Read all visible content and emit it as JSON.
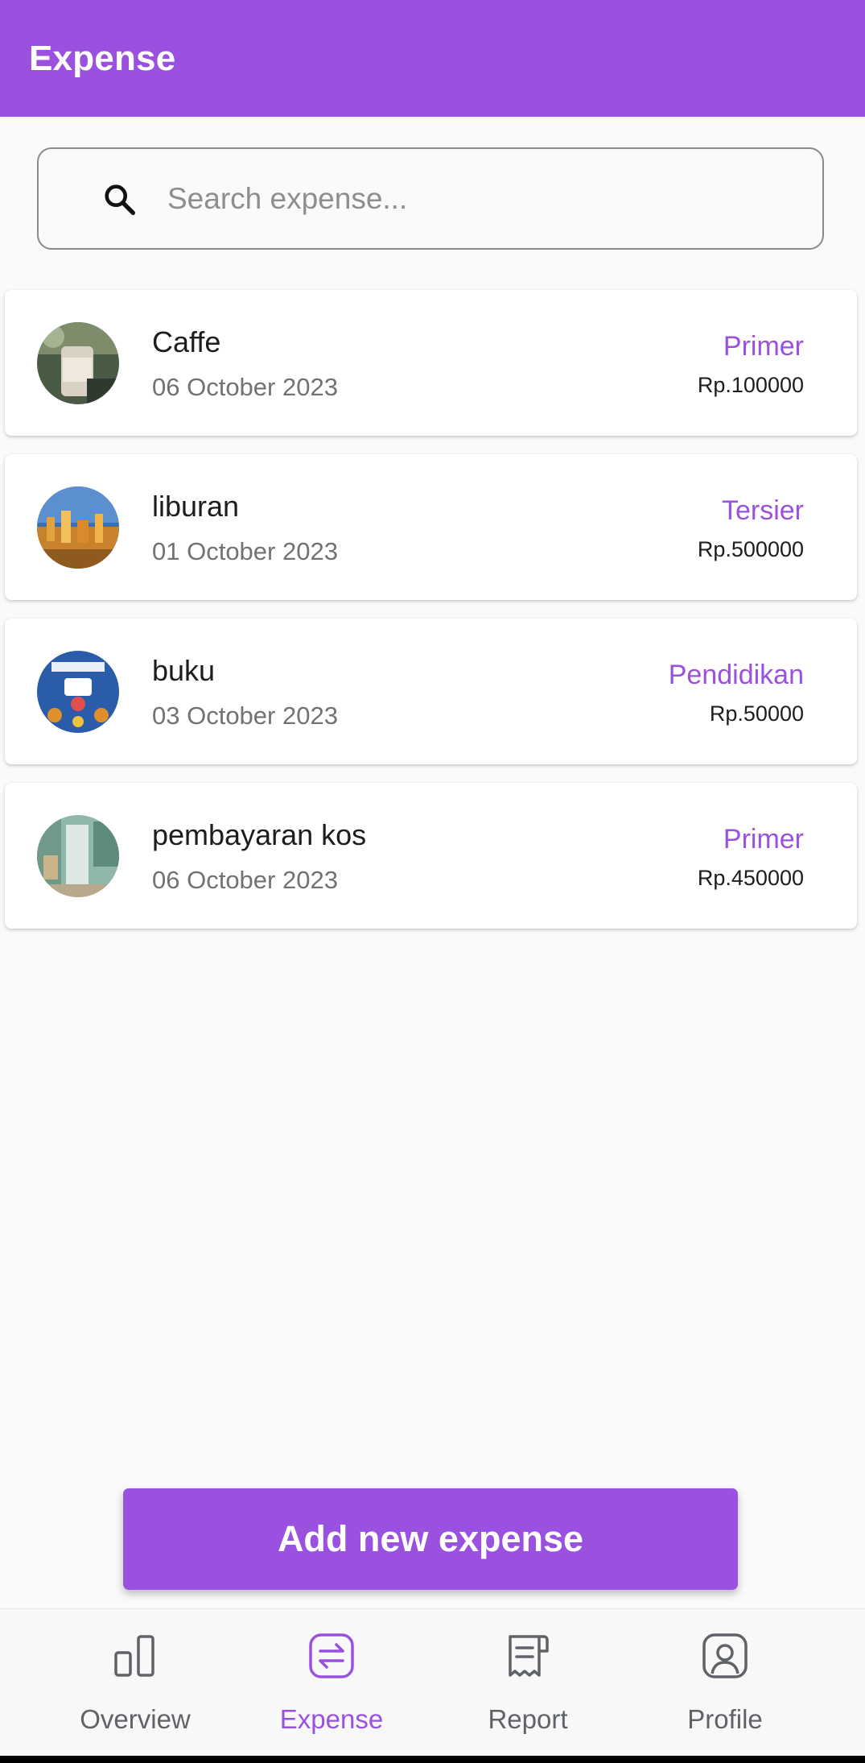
{
  "appbar": {
    "title": "Expense"
  },
  "search": {
    "placeholder": "Search expense...",
    "icon": "search-icon"
  },
  "expenses": [
    {
      "name": "Caffe",
      "date": "06 October 2023",
      "category": "Primer",
      "amount": "Rp.100000",
      "thumb": "coffee-photo"
    },
    {
      "name": "liburan",
      "date": "01 October 2023",
      "category": "Tersier",
      "amount": "Rp.500000",
      "thumb": "city-night-photo"
    },
    {
      "name": "buku",
      "date": "03 October 2023",
      "category": "Pendidikan",
      "amount": "Rp.50000",
      "thumb": "promo-poster-photo"
    },
    {
      "name": "pembayaran kos",
      "date": "06 October 2023",
      "category": "Primer",
      "amount": "Rp.450000",
      "thumb": "room-photo"
    }
  ],
  "add_button": {
    "label": "Add new expense"
  },
  "bottom_nav": {
    "items": [
      {
        "label": "Overview",
        "icon": "bar-chart-icon",
        "active": false
      },
      {
        "label": "Expense",
        "icon": "swap-icon",
        "active": true
      },
      {
        "label": "Report",
        "icon": "receipt-icon",
        "active": false
      },
      {
        "label": "Profile",
        "icon": "user-icon",
        "active": false
      }
    ]
  },
  "colors": {
    "accent": "#9b51e0",
    "background": "#fafafa",
    "nav_inactive": "#5f6368"
  }
}
